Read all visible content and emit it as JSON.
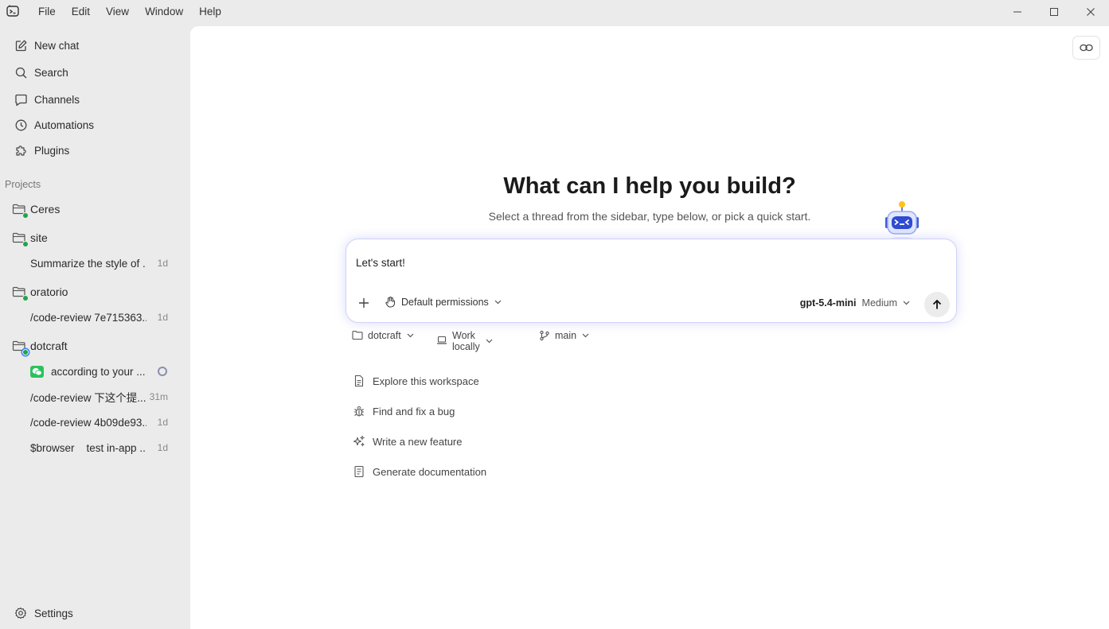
{
  "menu": [
    "File",
    "Edit",
    "View",
    "Window",
    "Help"
  ],
  "sidebar": {
    "nav": [
      {
        "label": "New chat",
        "icon": "edit-icon"
      },
      {
        "label": "Search",
        "icon": "search-icon"
      },
      {
        "label": "Channels",
        "icon": "chat-bubble-icon"
      },
      {
        "label": "Automations",
        "icon": "clock-icon"
      },
      {
        "label": "Plugins",
        "icon": "puzzle-icon"
      }
    ],
    "projects_label": "Projects",
    "projects": [
      {
        "name": "Ceres"
      },
      {
        "name": "site",
        "threads": [
          {
            "title": "Summarize the style of ...",
            "time": "1d"
          }
        ]
      },
      {
        "name": "oratorio",
        "threads": [
          {
            "title": "/code-review 7e715363...",
            "time": "1d"
          }
        ]
      },
      {
        "name": "dotcraft",
        "threads": [
          {
            "title": "according to your ...",
            "time": ""
          },
          {
            "title": "/code-review 下这个提...",
            "time": "31m"
          },
          {
            "title": "/code-review 4b09de93...",
            "time": "1d"
          },
          {
            "title": "$browser    test in-app ...",
            "time": "1d"
          }
        ]
      }
    ],
    "settings_label": "Settings"
  },
  "main": {
    "headline": "What can I help you build?",
    "subline": "Select a thread from the sidebar, type below, or pick a quick start.",
    "composer": {
      "value": "Let's start!",
      "permissions": "Default permissions",
      "model": "gpt-5.4-mini",
      "effort": "Medium"
    },
    "context": {
      "folder": "dotcraft",
      "location": "Work locally",
      "branch": "main"
    },
    "quick_starts": [
      {
        "label": "Explore this workspace",
        "icon": "document-icon"
      },
      {
        "label": "Find and fix a bug",
        "icon": "bug-icon"
      },
      {
        "label": "Write a new feature",
        "icon": "sparkle-icon"
      },
      {
        "label": "Generate documentation",
        "icon": "docs-icon"
      }
    ]
  },
  "colors": {
    "accent_glow": "#cfd3f5",
    "status_green": "#1ea64a",
    "wechat_green": "#2bc25e"
  }
}
